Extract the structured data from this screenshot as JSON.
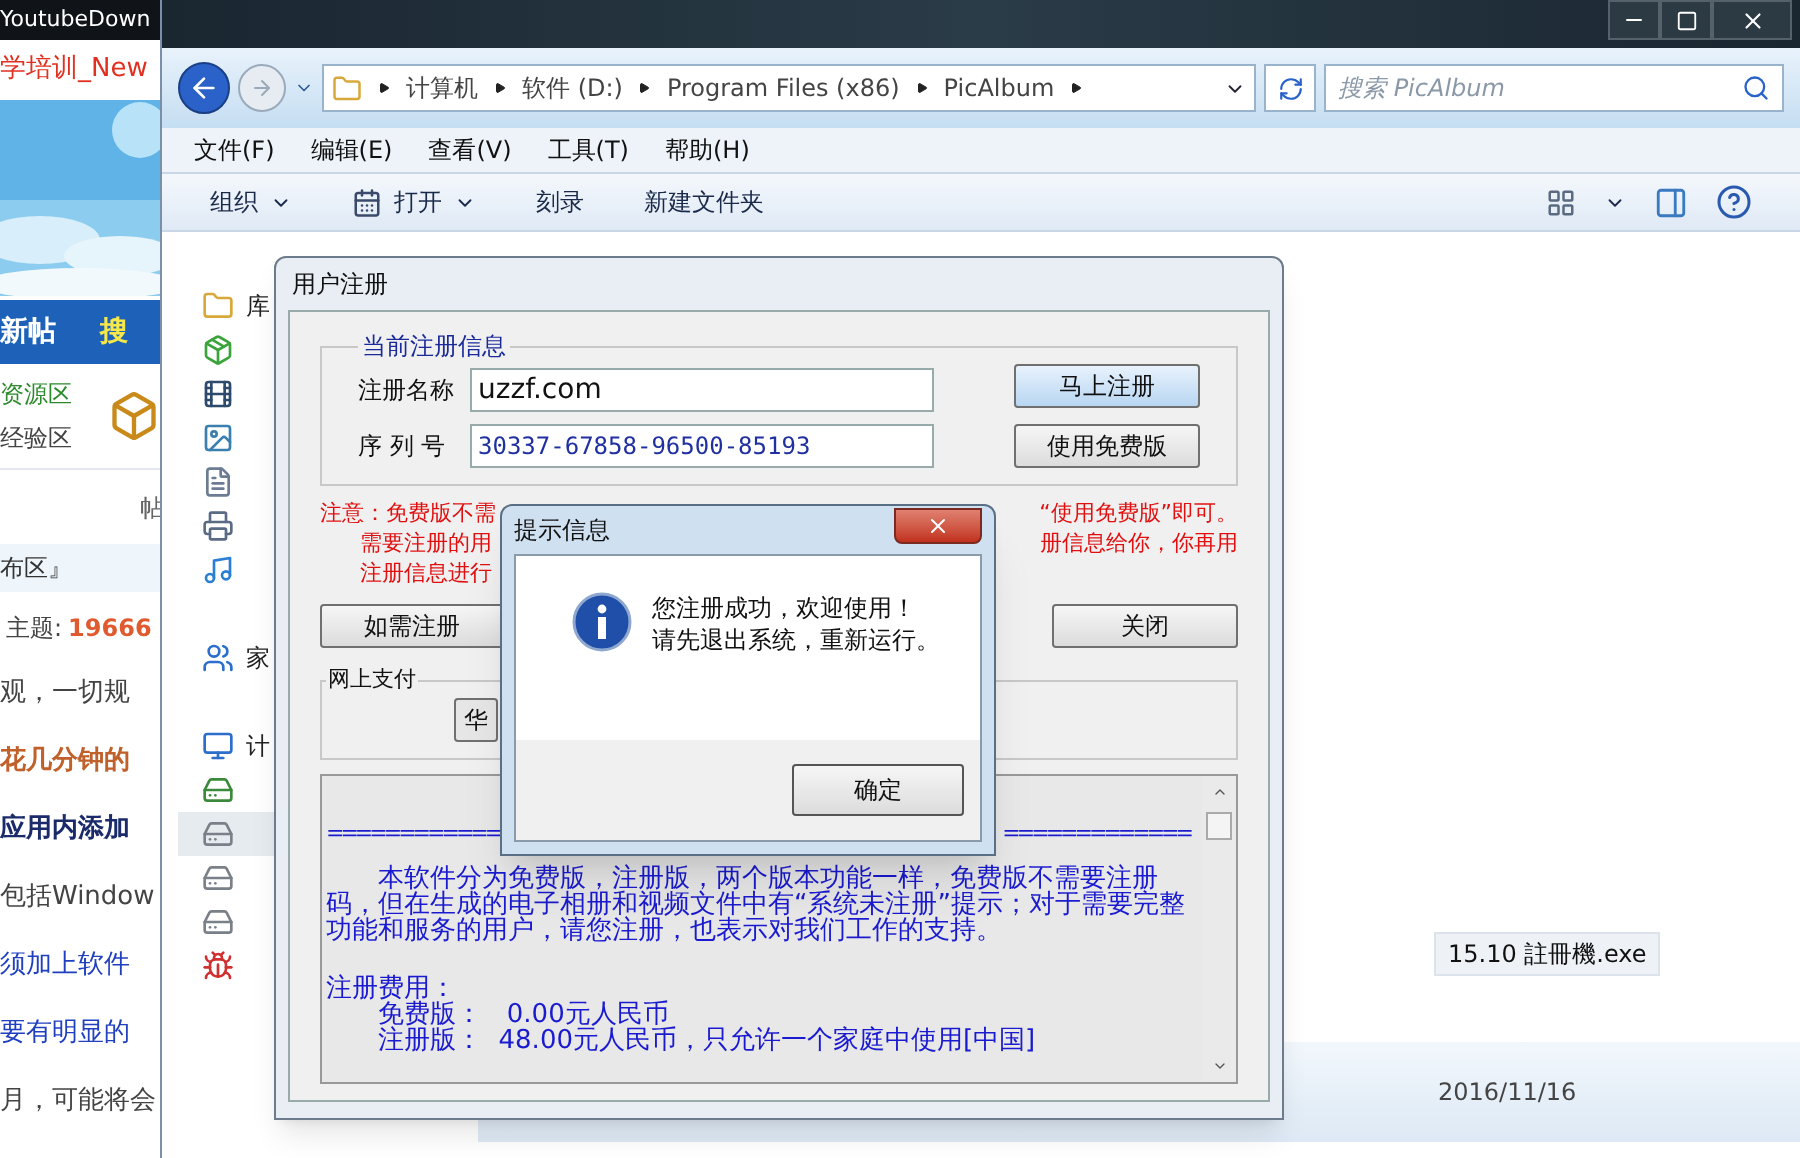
{
  "browser": {
    "tab_title": "YoutubeDown",
    "header_link": "学培训_New",
    "nav": [
      "新帖",
      "搜"
    ],
    "sections": [
      {
        "label": "资源区",
        "kind": "green"
      },
      {
        "label": "经验区",
        "kind": "plain"
      }
    ],
    "column_label": "帖",
    "breadcrumb": "布区』",
    "topics_label": "主题:",
    "topics_count": "19666",
    "lines": [
      {
        "text": "观，一切规",
        "kind": "plain"
      },
      {
        "text": "花几分钟的",
        "kind": "orange"
      },
      {
        "text": "应用内添加",
        "kind": "bold"
      },
      {
        "text": "包括Window",
        "kind": "plain"
      },
      {
        "text": "须加上软件",
        "kind": "link"
      },
      {
        "text": "要有明显的",
        "kind": "link"
      },
      {
        "text": "月，可能将会",
        "kind": "plain"
      }
    ]
  },
  "explorer": {
    "path": [
      "计算机",
      "软件 (D:)",
      "Program Files (x86)",
      "PicAlbum"
    ],
    "search": {
      "placeholder": "搜索 PicAlbum"
    },
    "menu": [
      "文件(F)",
      "编辑(E)",
      "查看(V)",
      "工具(T)",
      "帮助(H)"
    ],
    "toolbar": [
      {
        "label": "组织",
        "dropdown": true,
        "kind": "plain"
      },
      {
        "label": "打开",
        "dropdown": true,
        "kind": "open"
      },
      {
        "label": "刻录",
        "dropdown": false,
        "kind": "plain"
      },
      {
        "label": "新建文件夹",
        "dropdown": false,
        "kind": "plain"
      }
    ],
    "nav_groups": [
      {
        "items": [
          {
            "kind": "library",
            "label": "库",
            "selected": false
          },
          {
            "kind": "app",
            "selected": false
          },
          {
            "kind": "video",
            "selected": false
          },
          {
            "kind": "picture",
            "selected": false
          },
          {
            "kind": "document",
            "selected": false
          },
          {
            "kind": "printer",
            "selected": false
          },
          {
            "kind": "music",
            "selected": false
          }
        ]
      },
      {
        "items": [
          {
            "kind": "homegroup",
            "label": "家",
            "selected": false
          }
        ]
      },
      {
        "items": [
          {
            "kind": "computer",
            "label": "计",
            "selected": false
          },
          {
            "kind": "system-drive",
            "selected": false
          },
          {
            "kind": "drive",
            "selected": true
          },
          {
            "kind": "drive",
            "selected": false
          },
          {
            "kind": "drive",
            "selected": false
          },
          {
            "kind": "network",
            "selected": false
          }
        ]
      }
    ],
    "file": {
      "name": "15.10 註冊機.exe",
      "selected": true
    },
    "status_date": "2016/11/16"
  },
  "register_dialog": {
    "title": "用户注册",
    "info_group": {
      "title": "当前注册信息",
      "fields": [
        {
          "label": "注册名称",
          "value": "uzzf.com",
          "kind": "name"
        },
        {
          "label": "序 列 号",
          "value": "30337-67858-96500-85193",
          "kind": "serial"
        }
      ],
      "buttons": [
        {
          "label": "马上注册",
          "default": true
        },
        {
          "label": "使用免费版",
          "default": false
        }
      ]
    },
    "note_lines": [
      {
        "left": "注意：免费版不需",
        "right": "“使用免费版”即可。"
      },
      {
        "left": "需要注册的用",
        "right": "册信息给你，你再用"
      },
      {
        "left": "注册信息进行"
      }
    ],
    "action_buttons": [
      "如需注册",
      "关闭"
    ],
    "payment_group": {
      "title": "网上支付",
      "buttons": [
        "华"
      ]
    },
    "info_text": {
      "rule_left": "============",
      "rule_right": "=============",
      "paragraph": "本软件分为免费版，注册版，两个版本功能一样，免费版不需要注册码，但在生成的电子相册和视频文件中有“系统未注册”提示；对于需要完整功能和服务的用户，请您注册，也表示对我们工作的支持。",
      "fee_title": "注册费用：",
      "fees": [
        "免费版：   0.00元人民币",
        "注册版：  48.00元人民币，只允许一个家庭中使用[中国]"
      ]
    }
  },
  "message_box": {
    "title": "提示信息",
    "lines": [
      "您注册成功，欢迎使用！",
      "请先退出系统，重新运行。"
    ],
    "button": "确定"
  }
}
